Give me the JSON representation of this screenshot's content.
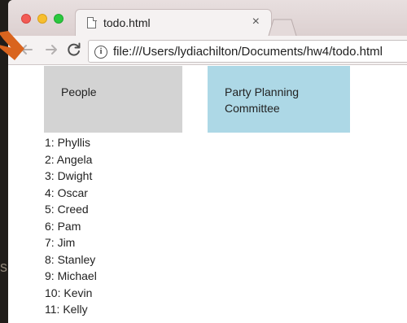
{
  "browser": {
    "tab_title": "todo.html",
    "tab_close": "×",
    "url": "file:///Users/lydiachilton/Documents/hw4/todo.html",
    "icons": {
      "back": "arrow-left-icon",
      "forward": "arrow-right-icon",
      "reload": "reload-icon",
      "info": "info-icon",
      "document": "document-icon"
    }
  },
  "desktop": {
    "edge_glyph": "s"
  },
  "boxes": {
    "people_label": "People",
    "party_label": "Party Planning Committee"
  },
  "people": [
    {
      "label": "1: Phyllis"
    },
    {
      "label": "2: Angela"
    },
    {
      "label": "3: Dwight"
    },
    {
      "label": "4: Oscar"
    },
    {
      "label": "5: Creed"
    },
    {
      "label": "6: Pam"
    },
    {
      "label": "7: Jim"
    },
    {
      "label": "8: Stanley"
    },
    {
      "label": "9: Michael"
    },
    {
      "label": "10: Kevin"
    },
    {
      "label": "11: Kelly"
    }
  ],
  "colors": {
    "people_box": "#d3d3d3",
    "party_box": "#add8e6",
    "annotation_arrow": "#d9641e"
  }
}
